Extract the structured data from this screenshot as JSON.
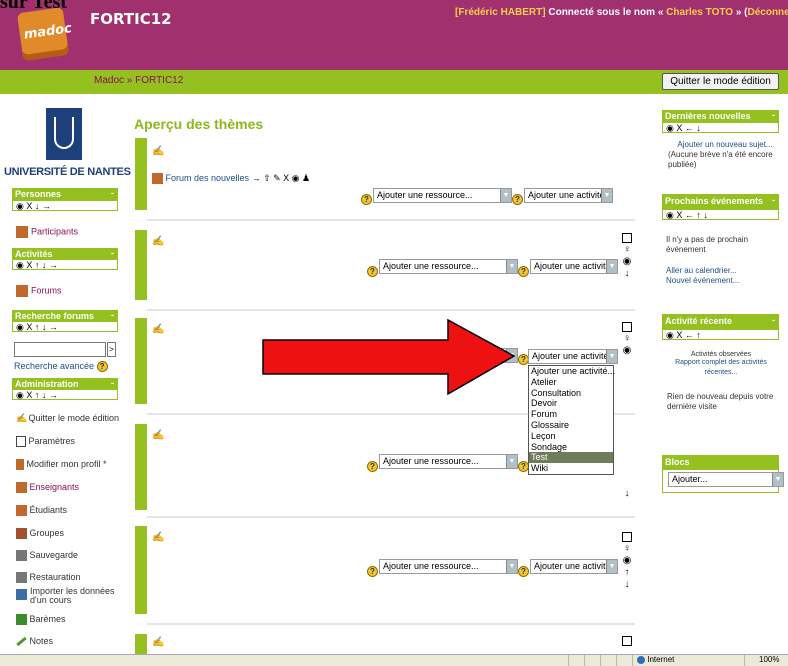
{
  "caption": "sur Test",
  "header": {
    "logo_text": "madoc",
    "site_name": "FORTIC12",
    "login": {
      "teacher": "[Frédéric HABERT]",
      "connected": "Connecté sous le nom «",
      "user": "Charles TOTO",
      "sep": "» (",
      "logout": "Déconnexion",
      "close": ")"
    }
  },
  "navbar": {
    "home": "Madoc",
    "sep": "»",
    "current": "FORTIC12",
    "edit_button": "Quitter le mode édition"
  },
  "university": "UNIVERSITÉ DE NANTES",
  "left": {
    "personnes": {
      "title": "Personnes",
      "controls": "◉ X ↓ →",
      "items": [
        "Participants"
      ]
    },
    "activites": {
      "title": "Activités",
      "controls": "◉ X ↑ ↓ →",
      "items": [
        "Forums"
      ]
    },
    "recherche": {
      "title": "Recherche forums",
      "controls": "◉ X ↑ ↓ →",
      "go": ">",
      "advanced": "Recherche avancée"
    },
    "admin": {
      "title": "Administration",
      "controls": "◉ X ↑ ↓ →",
      "items": [
        "Quitter le mode édition",
        "Paramètres",
        "Modifier mon profil *",
        "Enseignants",
        "Étudiants",
        "Groupes",
        "Sauvegarde",
        "Restauration",
        "Importer les données d'un cours",
        "Barèmes",
        "Notes"
      ]
    },
    "minimize": "-"
  },
  "main": {
    "title": "Aperçu des thèmes",
    "forum_link": "Forum des nouvelles",
    "forum_controls": "→ ⇧ ✎ X ◉ ♟",
    "add_resource": "Ajouter une ressource...",
    "add_activity": "Ajouter une activité...",
    "dropdown_options": [
      "Ajouter une activité...",
      "Atelier",
      "Consultation",
      "Devoir",
      "Forum",
      "Glossaire",
      "Leçon",
      "Sondage",
      "Test",
      "Wiki"
    ],
    "selected_option": "Test",
    "help": "?",
    "edit_icon": "✍",
    "section_icons": {
      "hilite": "☐",
      "bulb": "♀",
      "eye": "◉",
      "down": "↓",
      "up": "↑"
    }
  },
  "right": {
    "news": {
      "title": "Dernières nouvelles",
      "controls": "◉ X ← ↓",
      "add_topic": "Ajouter un nouveau sujet...",
      "empty": "(Aucune brève n'a été encore publiée)"
    },
    "events": {
      "title": "Prochains événements",
      "controls": "◉ X ← ↑ ↓",
      "empty": "Il n'y a pas de prochain événement",
      "calendar": "Aller au calendrier...",
      "new_event": "Nouvel événement..."
    },
    "recent": {
      "title": "Activité récente",
      "controls": "◉ X ← ↑",
      "observed": "Activités observées",
      "report": "Rapport complet des activités récentes...",
      "nothing": "Rien de nouveau depuis votre dernière visite"
    },
    "blocks": {
      "title": "Blocs",
      "add": "Ajouter..."
    },
    "minimize": "-"
  },
  "statusbar": {
    "zone": "Internet",
    "zoom": "100%"
  },
  "colors": {
    "header": "#a1306f",
    "accent": "#94c11f",
    "link": "#8f0e50",
    "arrow": "#ee1111"
  }
}
